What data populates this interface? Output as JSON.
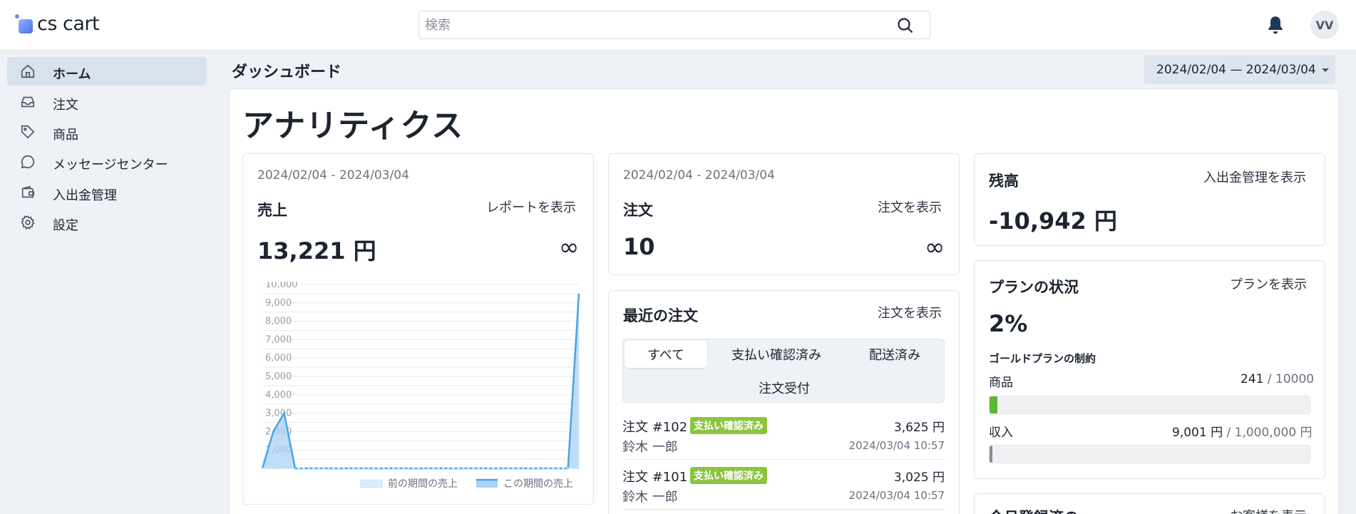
{
  "app": {
    "logo_text": "cs cart",
    "avatar_initials": "VV"
  },
  "search": {
    "placeholder": "検索"
  },
  "sidebar": {
    "items": [
      {
        "label": "ホーム",
        "icon": "home-icon",
        "active": true
      },
      {
        "label": "注文",
        "icon": "inbox-icon"
      },
      {
        "label": "商品",
        "icon": "tag-icon"
      },
      {
        "label": "メッセージセンター",
        "icon": "chat-icon"
      },
      {
        "label": "入出金管理",
        "icon": "wallet-icon"
      },
      {
        "label": "設定",
        "icon": "gear-icon"
      }
    ]
  },
  "header": {
    "title": "ダッシュボード",
    "date_range": "2024/02/04 — 2024/03/04"
  },
  "main": {
    "title": "アナリティクス"
  },
  "sales_card": {
    "date": "2024/02/04 - 2024/03/04",
    "title": "売上",
    "link": "レポートを表示",
    "value": "13,221 円",
    "change": "∞"
  },
  "orders_card": {
    "date": "2024/02/04 - 2024/03/04",
    "title": "注文",
    "link": "注文を表示",
    "value": "10",
    "change": "∞"
  },
  "recent_orders": {
    "title": "最近の注文",
    "link": "注文を表示",
    "tabs": [
      "すべて",
      "支払い確認済み",
      "配送済み",
      "注文受付"
    ],
    "rows": [
      {
        "order": "注文 #102",
        "status": "支払い確認済み",
        "amount": "3,625 円",
        "customer": "鈴木 一郎",
        "date": "2024/03/04 10:57"
      },
      {
        "order": "注文 #101",
        "status": "支払い確認済み",
        "amount": "3,025 円",
        "customer": "鈴木 一郎",
        "date": "2024/03/04 10:57"
      }
    ]
  },
  "balance_card": {
    "title": "残高",
    "link": "入出金管理を表示",
    "value": "-10,942 円"
  },
  "plan_card": {
    "title": "プランの状況",
    "link": "プランを表示",
    "percent": "2%",
    "subtitle": "ゴールドプランの制約",
    "products": {
      "label": "商品",
      "used": "241",
      "sep": " / ",
      "limit": "10000",
      "fraction": 0.0241
    },
    "revenue": {
      "label": "収入",
      "used": "9,001 円",
      "sep": " / ",
      "limit": "1,000,000 円",
      "fraction": 0.009
    }
  },
  "next_card": {
    "title": "今月登録済の",
    "link": "お客様を表示"
  },
  "colors": {
    "accent": "#4aa3e8",
    "badge": "#8bc53f",
    "progress_products": "#5cb82e",
    "progress_revenue": "#8a8f96"
  },
  "chart_data": {
    "type": "area",
    "ylim": [
      0,
      10000
    ],
    "yticks": [
      "10,000",
      "9,000",
      "8,000",
      "7,000",
      "6,000",
      "5,000",
      "4,000",
      "3,000",
      "2,000",
      "1,000"
    ],
    "x": [
      1,
      2,
      3,
      4,
      5,
      6,
      7,
      8,
      9,
      10,
      11,
      12,
      13,
      14,
      15,
      16,
      17,
      18,
      19,
      20,
      21,
      22,
      23,
      24,
      25,
      26,
      27,
      28,
      29,
      30
    ],
    "series": [
      {
        "name": "前の期間の売上",
        "style": "dashed",
        "values": [
          0,
          0,
          0,
          0,
          0,
          0,
          0,
          0,
          0,
          0,
          0,
          0,
          0,
          0,
          0,
          0,
          0,
          0,
          0,
          0,
          0,
          0,
          0,
          0,
          0,
          0,
          0,
          0,
          0,
          0
        ]
      },
      {
        "name": "この期間の売上",
        "style": "solid",
        "values": [
          0,
          2000,
          3000,
          0,
          0,
          0,
          0,
          0,
          0,
          0,
          0,
          0,
          0,
          0,
          0,
          0,
          0,
          0,
          0,
          0,
          0,
          0,
          0,
          0,
          0,
          0,
          0,
          0,
          0,
          9500
        ]
      }
    ],
    "grid": true,
    "legend": "bottom-right"
  }
}
